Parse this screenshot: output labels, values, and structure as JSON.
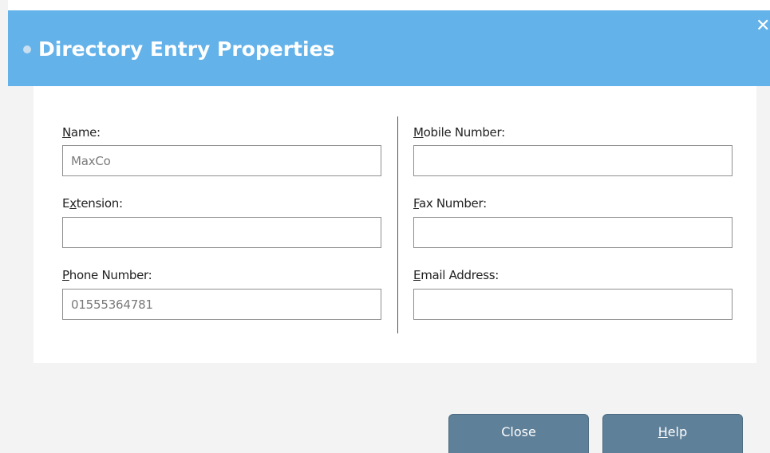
{
  "dialog": {
    "title": "Directory Entry Properties",
    "close_glyph": "✕"
  },
  "fields": {
    "name": {
      "label_first": "N",
      "label_rest": "ame:",
      "value": "MaxCo"
    },
    "extension": {
      "label_first": "E",
      "label_underlined": "x",
      "label_rest": "tension:",
      "value": ""
    },
    "phone": {
      "label_first": "P",
      "label_rest": "hone Number:",
      "value": "01555364781"
    },
    "mobile": {
      "label_first": "M",
      "label_rest": "obile Number:",
      "value": ""
    },
    "fax": {
      "label_first": "F",
      "label_rest": "ax Number:",
      "value": ""
    },
    "email": {
      "label_first": "E",
      "label_rest": "mail Address:",
      "value": ""
    }
  },
  "buttons": {
    "close_label": "Close",
    "help_first": "H",
    "help_rest": "elp"
  },
  "colors": {
    "title_bar": "#63b2e9",
    "button": "#5f8099",
    "panel": "#ffffff",
    "background": "#f3f3f3"
  }
}
